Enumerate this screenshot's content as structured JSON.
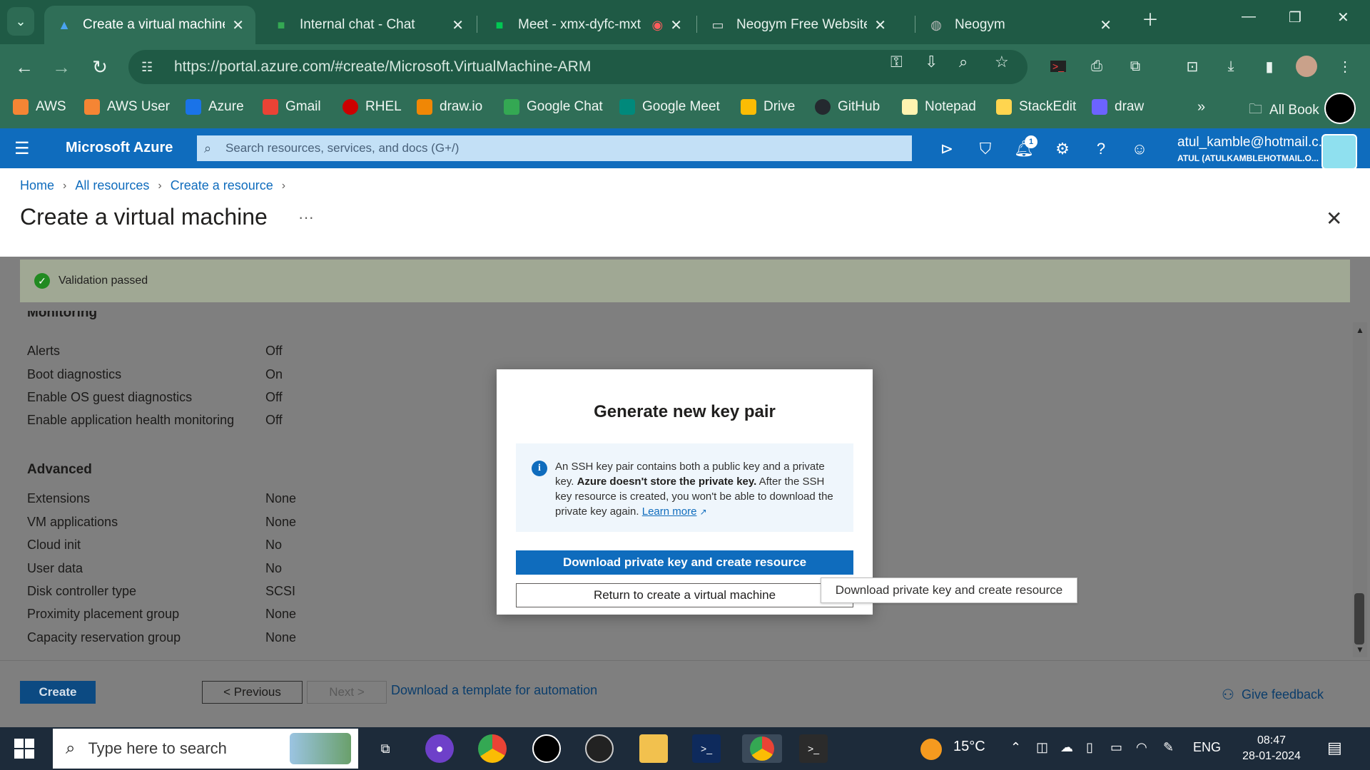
{
  "browser": {
    "tabs": [
      {
        "label": "Create a virtual machine",
        "fav": "azure-icon"
      },
      {
        "label": "Internal chat - Chat",
        "fav": "google-chat-icon"
      },
      {
        "label": "Meet - xmx-dyfc-mxt",
        "fav": "google-meet-icon"
      },
      {
        "label": "Neogym Free Website Te",
        "fav": "website-icon"
      },
      {
        "label": "Neogym",
        "fav": "globe-icon"
      }
    ],
    "url": "https://portal.azure.com/#create/Microsoft.VirtualMachine-ARM",
    "bookmarks": [
      {
        "label": "AWS",
        "color": "#f58534"
      },
      {
        "label": "AWS User",
        "color": "#f58534"
      },
      {
        "label": "Azure",
        "color": "#1a73e8"
      },
      {
        "label": "Gmail",
        "color": "#ea4335"
      },
      {
        "label": "RHEL",
        "color": "#cc0000"
      },
      {
        "label": "draw.io",
        "color": "#f08705"
      },
      {
        "label": "Google Chat",
        "color": "#34a853"
      },
      {
        "label": "Google Meet",
        "color": "#00897b"
      },
      {
        "label": "Drive",
        "color": "#fbbc04"
      },
      {
        "label": "GitHub",
        "color": "#24292f"
      },
      {
        "label": "Notepad",
        "color": "#fff3b0"
      },
      {
        "label": "StackEdit",
        "color": "#ffd54f"
      },
      {
        "label": "draw",
        "color": "#6c63ff"
      }
    ],
    "all_bookmarks": "All Book"
  },
  "azure": {
    "brand": "Microsoft Azure",
    "search_placeholder": "Search resources, services, and docs (G+/)",
    "notification_count": "1",
    "account_name": "atul_kamble@hotmail.c...",
    "account_directory": "ATUL (ATULKAMBLEHOTMAIL.O..."
  },
  "page": {
    "breadcrumb": [
      "Home",
      "All resources",
      "Create a resource"
    ],
    "title": "Create a virtual machine",
    "more": "···",
    "validation": "Validation passed"
  },
  "monitoring": {
    "heading": "Monitoring",
    "rows": [
      {
        "label": "Alerts",
        "value": "Off"
      },
      {
        "label": "Boot diagnostics",
        "value": "On"
      },
      {
        "label": "Enable OS guest diagnostics",
        "value": "Off"
      },
      {
        "label": "Enable application health monitoring",
        "value": "Off"
      }
    ]
  },
  "advanced": {
    "heading": "Advanced",
    "rows": [
      {
        "label": "Extensions",
        "value": "None"
      },
      {
        "label": "VM applications",
        "value": "None"
      },
      {
        "label": "Cloud init",
        "value": "No"
      },
      {
        "label": "User data",
        "value": "No"
      },
      {
        "label": "Disk controller type",
        "value": "SCSI"
      },
      {
        "label": "Proximity placement group",
        "value": "None"
      },
      {
        "label": "Capacity reservation group",
        "value": "None"
      }
    ]
  },
  "footer": {
    "create": "Create",
    "previous": "< Previous",
    "next": "Next >",
    "template_link": "Download a template for automation",
    "feedback": "Give feedback"
  },
  "dialog": {
    "title": "Generate new key pair",
    "info_part1": "An SSH key pair contains both a public key and a private key. ",
    "info_bold": "Azure doesn't store the private key.",
    "info_part2": " After the SSH key resource is created, you won't be able to download the private key again. ",
    "learn_more": "Learn more",
    "primary": "Download private key and create resource",
    "secondary": "Return to create a virtual machine",
    "tooltip": "Download private key and create resource"
  },
  "taskbar": {
    "search_placeholder": "Type here to search",
    "temperature": "15°C",
    "language": "ENG",
    "time": "08:47",
    "date": "28-01-2024"
  }
}
